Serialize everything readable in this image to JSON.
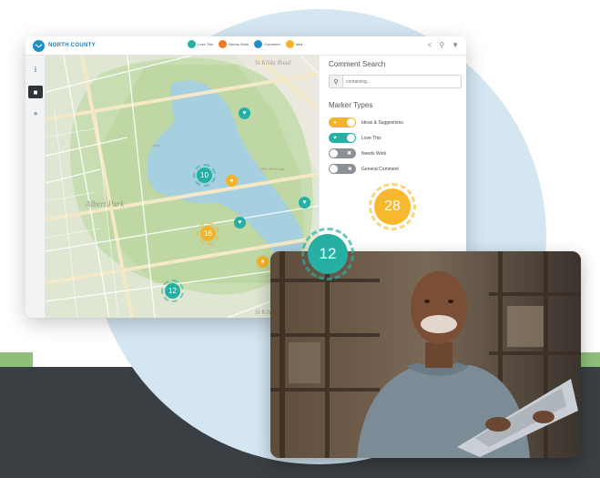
{
  "header": {
    "brand": "NORTH COUNTY",
    "legend": [
      {
        "label": "Love This",
        "color": "#26b0a4",
        "icon": "heart-icon"
      },
      {
        "label": "Needs Work",
        "color": "#f07a2a",
        "icon": "wrench-icon"
      },
      {
        "label": "Comment",
        "color": "#1f8fc8",
        "icon": "comment-icon"
      },
      {
        "label": "Idea",
        "color": "#f2b32a",
        "icon": "lightbulb-icon"
      }
    ],
    "actions": [
      "share-icon",
      "search-icon",
      "filter-icon"
    ]
  },
  "sidebar": {
    "items": [
      {
        "icon": "info-icon",
        "label": "",
        "active": false
      },
      {
        "icon": "comments-icon",
        "label": "",
        "active": true
      },
      {
        "icon": "user-icon",
        "label": "",
        "active": false
      }
    ]
  },
  "map": {
    "labels": [
      "St Kilda Road",
      "Albert Park",
      "Lake",
      "St Kilda",
      "Albert Park Lake"
    ],
    "clusters": [
      {
        "count": "10",
        "color": "#26b0a4"
      },
      {
        "count": "16",
        "color": "#f2b32a"
      },
      {
        "count": "12",
        "color": "#26b0a4"
      }
    ]
  },
  "panel": {
    "search_title": "Comment Search",
    "search_placeholder": "containing...",
    "marker_types_title": "Marker Types",
    "marker_types": [
      {
        "label": "Ideas & Suggestions",
        "color": "#f2b32a",
        "state": "on",
        "icon": "lightbulb-icon"
      },
      {
        "label": "Love This",
        "color": "#26b0a4",
        "state": "on",
        "icon": "heart-icon"
      },
      {
        "label": "Needs Work",
        "color": "#8a9096",
        "state": "off",
        "icon": "wrench-icon"
      },
      {
        "label": "General Comment",
        "color": "#8a9096",
        "state": "off",
        "icon": "comment-icon"
      }
    ],
    "badge_count": "28"
  },
  "overlay": {
    "badge_count": "12"
  },
  "colors": {
    "teal": "#26b0a4",
    "yellow": "#f2b32a",
    "brand_blue": "#1f8fc8",
    "background_circle": "#d4e6f1",
    "dark_band": "#3a3f44"
  }
}
